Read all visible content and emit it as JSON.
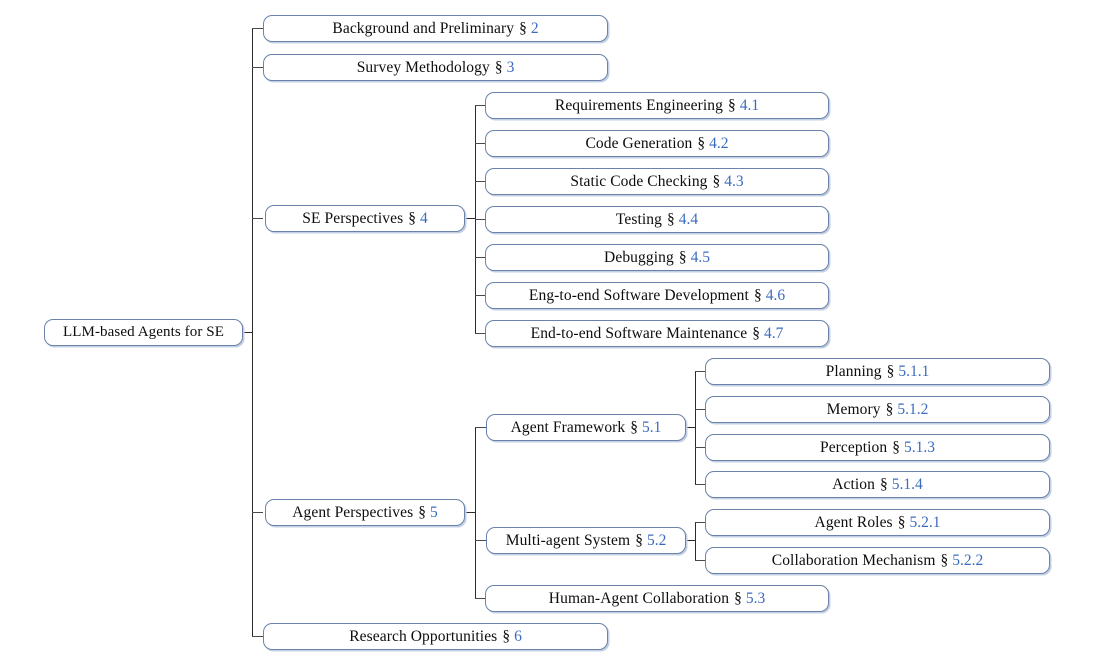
{
  "figure": {
    "type": "taxonomy-tree",
    "orientation": "left-to-right",
    "section_symbol": "§",
    "colors": {
      "box_border": "#6b83ab",
      "box_shadow": "#c3d0e4",
      "connector": "#2b2b2b",
      "section_number": "#3b6bbf",
      "label_text": "#0d0d0d",
      "background": "#ffffff"
    }
  },
  "root": {
    "label": "LLM-based Agents for SE",
    "section": ""
  },
  "level1": [
    {
      "label": "Background and Preliminary",
      "section": "2"
    },
    {
      "label": "Survey Methodology",
      "section": "3"
    },
    {
      "label": "SE Perspectives",
      "section": "4"
    },
    {
      "label": "Agent Perspectives",
      "section": "5"
    },
    {
      "label": "Research Opportunities",
      "section": "6"
    }
  ],
  "se_perspectives_children": [
    {
      "label": "Requirements Engineering",
      "section": "4.1"
    },
    {
      "label": "Code Generation",
      "section": "4.2"
    },
    {
      "label": "Static Code Checking",
      "section": "4.3"
    },
    {
      "label": "Testing",
      "section": "4.4"
    },
    {
      "label": "Debugging",
      "section": "4.5"
    },
    {
      "label": "Eng-to-end Software Development",
      "section": "4.6"
    },
    {
      "label": "End-to-end Software Maintenance",
      "section": "4.7"
    }
  ],
  "agent_perspectives_children": [
    {
      "label": "Agent Framework",
      "section": "5.1"
    },
    {
      "label": "Multi-agent System",
      "section": "5.2"
    },
    {
      "label": "Human-Agent Collaboration",
      "section": "5.3"
    }
  ],
  "agent_framework_children": [
    {
      "label": "Planning",
      "section": "5.1.1"
    },
    {
      "label": "Memory",
      "section": "5.1.2"
    },
    {
      "label": "Perception",
      "section": "5.1.3"
    },
    {
      "label": "Action",
      "section": "5.1.4"
    }
  ],
  "multi_agent_system_children": [
    {
      "label": "Agent Roles",
      "section": "5.2.1"
    },
    {
      "label": "Collaboration Mechanism",
      "section": "5.2.2"
    }
  ]
}
